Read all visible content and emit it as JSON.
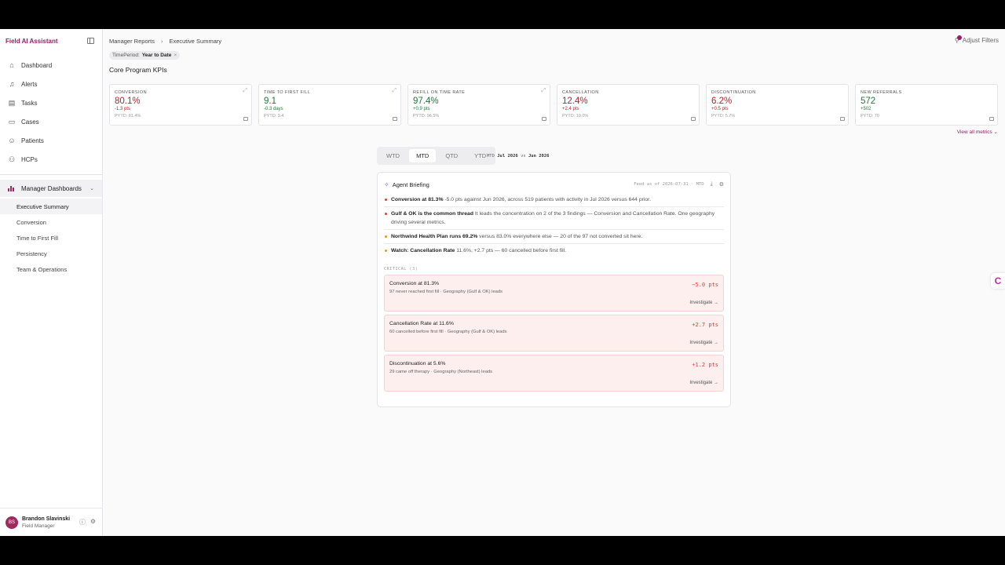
{
  "app": {
    "title": "Field AI Assistant"
  },
  "nav": [
    {
      "label": "Dashboard",
      "icon": "home-icon"
    },
    {
      "label": "Alerts",
      "icon": "bell-icon"
    },
    {
      "label": "Tasks",
      "icon": "clipboard-icon"
    },
    {
      "label": "Cases",
      "icon": "folder-icon"
    },
    {
      "label": "Patients",
      "icon": "user-icon"
    },
    {
      "label": "HCPs",
      "icon": "people-icon"
    }
  ],
  "manager": {
    "label": "Manager Dashboards"
  },
  "subnav": [
    {
      "label": "Executive Summary",
      "active": true
    },
    {
      "label": "Conversion"
    },
    {
      "label": "Time to First Fill"
    },
    {
      "label": "Persistency"
    },
    {
      "label": "Team & Operations"
    }
  ],
  "user": {
    "initials": "BS",
    "name": "Brandon Slavinski",
    "role": "Field Manager"
  },
  "breadcrumb": {
    "parent": "Manager Reports",
    "current": "Executive Summary"
  },
  "filters": {
    "adjust_label": "Adjust Filters",
    "badge": "1"
  },
  "chip": {
    "key": "TimePeriod:",
    "value": "Year to Date",
    "close": "×"
  },
  "kpi_section": {
    "title": "Core Program KPIs",
    "view_all": "View all metrics ⌄"
  },
  "kpis": [
    {
      "label": "Conversion",
      "value": "80.1%",
      "delta": "-1.3 pts",
      "pytd": "PYTD: 81.4%",
      "tone": "red"
    },
    {
      "label": "Time to First Fill",
      "value": "9.1",
      "delta": "-0.3 days",
      "pytd": "PYTD: 9.4",
      "tone": "green"
    },
    {
      "label": "Refill on Time Rate",
      "value": "97.4%",
      "delta": "+0.9 pts",
      "pytd": "PYTD: 96.5%",
      "tone": "green"
    },
    {
      "label": "Cancellation",
      "value": "12.4%",
      "delta": "+2.4 pts",
      "pytd": "PYTD: 10.0%",
      "tone": "red"
    },
    {
      "label": "Discontinuation",
      "value": "6.2%",
      "delta": "+0.5 pts",
      "pytd": "PYTD: 5.7%",
      "tone": "red"
    },
    {
      "label": "New Referrals",
      "value": "572",
      "delta": "+502",
      "pytd": "PYTD: 70",
      "tone": "green"
    }
  ],
  "period_tabs": [
    "WTD",
    "MTD",
    "QTD",
    "YTD"
  ],
  "period_active": "MTD",
  "period_caption": {
    "prefix": "MTD",
    "current": "Jul 2026",
    "vs": "vs",
    "compare": "Jun 2026"
  },
  "briefing": {
    "title": "Agent Briefing",
    "meta": "Feed as of 2026-07-31 · MTD",
    "bullets": [
      {
        "bold": "Conversion at 81.3%",
        "text": " -5.0 pts against Jun 2026, across 519 patients with activity in Jul 2026 versus 644 prior.",
        "color": "#c8483a"
      },
      {
        "bold": "Gulf & OK is the common thread",
        "text": " It leads the concentration on 2 of the 3 findings — Conversion and Cancellation Rate. One geography driving several metrics.",
        "color": "#c8483a"
      },
      {
        "bold": "Northwind Health Plan runs 69.2%",
        "text": " versus 83.0% everywhere else — 20 of the 97 not converted sit here.",
        "color": "#d9a227"
      },
      {
        "bold": "Watch: Cancellation Rate",
        "text": " 11.6%, +2.7 pts — 60 cancelled before first fill.",
        "color": "#d9a227"
      }
    ],
    "critical_label": "CRITICAL (3)",
    "cards": [
      {
        "title": "Conversion at 81.3%",
        "sub": "97 never reached first fill · Geography (Gulf & OK) leads",
        "delta": "−5.0 pts",
        "action": "Investigate →"
      },
      {
        "title": "Cancellation Rate at 11.6%",
        "sub": "60 cancelled before first fill · Geography (Gulf & OK) leads",
        "delta": "+2.7 pts",
        "action": "Investigate →"
      },
      {
        "title": "Discontinuation at 5.6%",
        "sub": "29 came off therapy · Geography (Northeast) leads",
        "delta": "+1.2 pts",
        "action": "Investigate →"
      }
    ]
  },
  "colors": {
    "brand": "#9b1c63",
    "negative": "#b4232b",
    "positive": "#1e7b3a",
    "critical_bg": "#fcefee"
  },
  "widget": {
    "glyph": "C"
  }
}
